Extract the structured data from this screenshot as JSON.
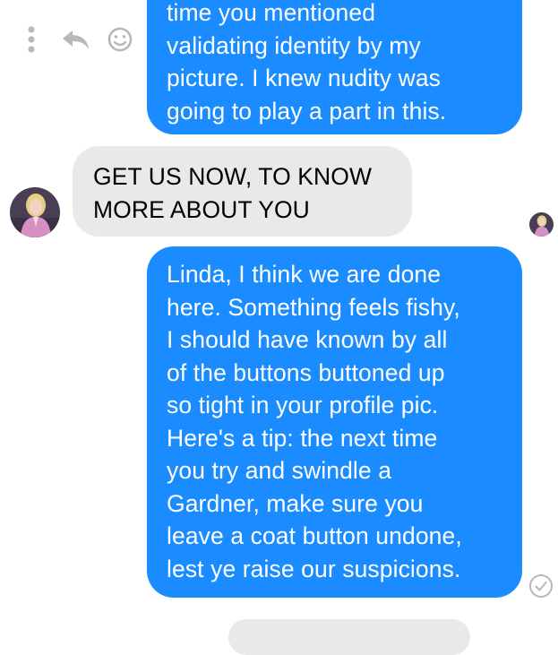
{
  "conversation": {
    "messages": [
      {
        "id": "msg-1",
        "direction": "outgoing",
        "text": "time you mentioned\nvalidating identity by my\npicture. I knew nudity was\ngoing to play a part in this."
      },
      {
        "id": "msg-2",
        "direction": "incoming",
        "text": "GET US NOW, TO KNOW\nMORE ABOUT YOU"
      },
      {
        "id": "msg-3",
        "direction": "outgoing",
        "text": "Linda, I think we are done\nhere. Something feels fishy,\nI should have known by all\nof the buttons buttoned up\nso tight in your profile pic.\nHere's a tip: the next time\nyou try and swindle a\nGardner, make sure you\nleave a coat button undone,\nlest ye raise our suspicions."
      }
    ],
    "message_actions": [
      "more-options-icon",
      "reply-icon",
      "emoji-reaction-icon"
    ],
    "status_icons": [
      "sender-avatar",
      "seen-avatar",
      "read-check-icon"
    ]
  },
  "colors": {
    "outgoing_bubble": "#1a8cff",
    "incoming_bubble": "#e9e9eb",
    "action_icon": "#b8b8bc",
    "background": "#ffffff"
  }
}
